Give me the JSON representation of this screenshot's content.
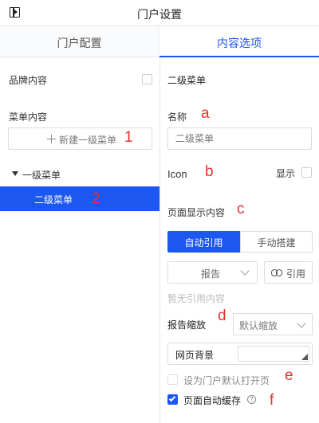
{
  "header": {
    "title": "门户设置",
    "panel_icon": "panel-toggle-icon"
  },
  "tabs": [
    {
      "label": "门户配置",
      "active": false
    },
    {
      "label": "内容选项",
      "active": true
    }
  ],
  "left": {
    "brand_label": "品牌内容",
    "menu_label": "菜单内容",
    "new_button_label": "新建一级菜单",
    "tree": {
      "level1_label": "一级菜单",
      "level2_label": "二级菜单"
    }
  },
  "right": {
    "section_title": "二级菜单",
    "name_label": "名称",
    "name_placeholder": "二级菜单",
    "icon_label": "Icon",
    "show_label": "显示",
    "page_content_label": "页面显示内容",
    "mode_buttons": {
      "auto": "自动引用",
      "manual": "手动搭建"
    },
    "report_select_value": "报告",
    "quote_button_label": "引用",
    "no_reference_text": "暂无引用内容",
    "zoom_label": "报告缩放",
    "zoom_value": "默认缩放",
    "background_label": "网页背景",
    "default_open_label": "设为门户默认打开页",
    "auto_cache_label": "页面自动缓存",
    "auto_cache_checked": true
  },
  "annotations": {
    "a": "a",
    "b": "b",
    "c": "c",
    "d": "d",
    "e": "e",
    "f": "f",
    "n1": "1",
    "n2": "2"
  },
  "colors": {
    "accent": "#1d57f2",
    "red": "#e8322b"
  }
}
